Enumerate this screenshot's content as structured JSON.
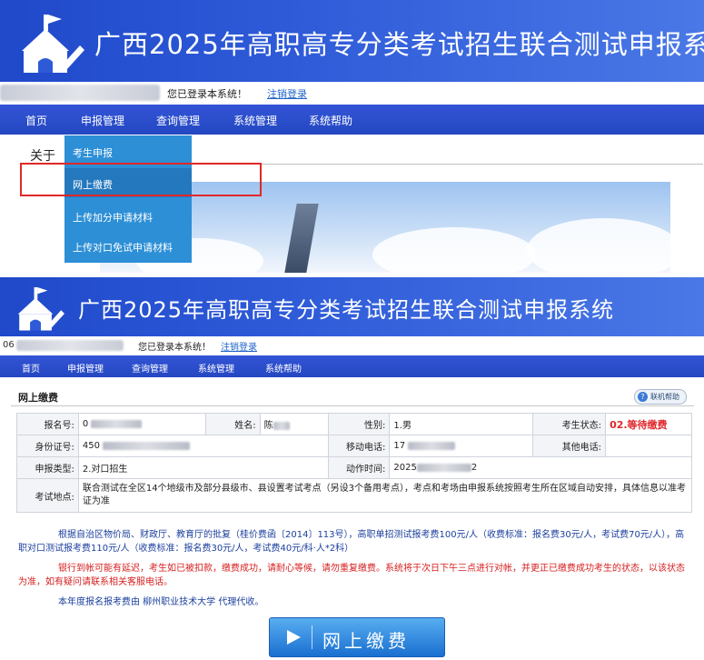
{
  "app": {
    "title": "广西2025年高职高专分类考试招生联合测试申报系统",
    "login_message": "您已登录本系统！",
    "logout_link": "注销登录",
    "user_id_partial": "06"
  },
  "nav": [
    "首页",
    "申报管理",
    "查询管理",
    "系统管理",
    "系统帮助"
  ],
  "panel1": {
    "about": "关于",
    "dropdown": [
      "考生申报",
      "网上缴费",
      "上传加分申请材料",
      "上传对口免试申请材料"
    ]
  },
  "panel2": {
    "section_title": "网上缴费",
    "help_button": "联机帮助",
    "fields": {
      "reg_no_label": "报名号:",
      "reg_no_value": "0",
      "name_label": "姓名:",
      "name_value": "陈",
      "gender_label": "性别:",
      "gender_value": "1.男",
      "status_label": "考生状态:",
      "status_value": "02.等待缴费",
      "id_label": "身份证号:",
      "id_value": "450",
      "mobile_label": "移动电话:",
      "mobile_value": "17",
      "other_phone_label": "其他电话:",
      "other_phone_value": "",
      "type_label": "申报类型:",
      "type_value": "2.对口招生",
      "action_time_label": "动作时间:",
      "action_time_value_prefix": "2025",
      "action_time_value_suffix": "2",
      "location_label": "考试地点:",
      "location_value": "联合测试在全区14个地级市及部分县级市、县设置考试考点（另设3个备用考点），考点和考场由申报系统按照考生所在区域自动安排，具体信息以准考证为准"
    },
    "notice_fee": "根据自治区物价局、财政厅、教育厅的批复（桂价费函〔2014〕113号），高职单招测试报考费100元/人（收费标准：报名费30元/人，考试费70元/人），高职对口测试报考费110元/人（收费标准：报名费30元/人，考试费40元/科·人*2科）",
    "notice_warning": "银行到帐可能有延迟，考生如已被扣款，缴费成功，请耐心等候，请勿重复缴费。系统将于次日下午三点进行对帐，并更正已缴费成功考生的状态，以该状态为准，如有疑问请联系相关客服电话。",
    "notice_agent": "本年度报名报考费由 柳州职业技术大学 代理代收。",
    "pay_button": "网上缴费"
  },
  "colors": {
    "banner": "#2e5ad8",
    "dropdown": "#2d8fd6",
    "status_red": "#e0262a",
    "notice_blue": "#1b3f9e",
    "warning_red": "#d62020",
    "highlight_box": "#e02828"
  },
  "icons": [
    "school-logo-icon",
    "help-icon",
    "play-icon"
  ]
}
